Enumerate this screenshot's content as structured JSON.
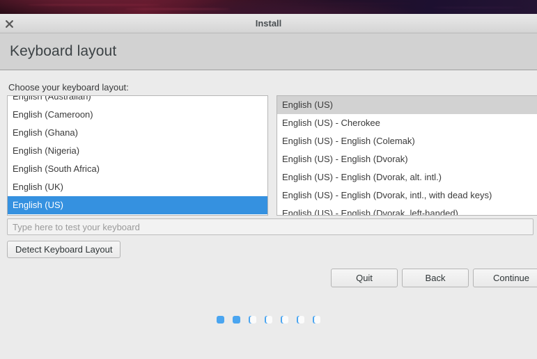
{
  "window": {
    "title": "Install",
    "close_icon": "close-icon"
  },
  "page": {
    "heading": "Keyboard layout",
    "choose_label": "Choose your keyboard layout:"
  },
  "keyboard_languages": {
    "items": [
      {
        "label": "English (Australian)",
        "selected": false,
        "clipped_top": true
      },
      {
        "label": "English (Cameroon)",
        "selected": false
      },
      {
        "label": "English (Ghana)",
        "selected": false
      },
      {
        "label": "English (Nigeria)",
        "selected": false
      },
      {
        "label": "English (South Africa)",
        "selected": false
      },
      {
        "label": "English (UK)",
        "selected": false
      },
      {
        "label": "English (US)",
        "selected": true
      }
    ]
  },
  "keyboard_variants": {
    "items": [
      {
        "label": "English (US)",
        "selected": true
      },
      {
        "label": "English (US) - Cherokee",
        "selected": false
      },
      {
        "label": "English (US) - English (Colemak)",
        "selected": false
      },
      {
        "label": "English (US) - English (Dvorak)",
        "selected": false
      },
      {
        "label": "English (US) - English (Dvorak, alt. intl.)",
        "selected": false
      },
      {
        "label": "English (US) - English (Dvorak, intl., with dead keys)",
        "selected": false
      },
      {
        "label": "English (US) - English (Dvorak, left-handed)",
        "selected": false
      }
    ]
  },
  "test_field": {
    "placeholder": "Type here to test your keyboard",
    "value": ""
  },
  "detect_button": {
    "label": "Detect Keyboard Layout"
  },
  "nav": {
    "quit": "Quit",
    "back": "Back",
    "continue": "Continue"
  },
  "progress": {
    "total": 7,
    "completed": 2,
    "dots": [
      "on",
      "on",
      "off",
      "off",
      "off",
      "off",
      "off"
    ]
  },
  "colors": {
    "selection_blue": "#3591e0",
    "selection_grey": "#d2d2d2",
    "accent_dot": "#4aa5f0",
    "window_bg": "#ebebeb",
    "heading_bg": "#d2d2d2"
  }
}
